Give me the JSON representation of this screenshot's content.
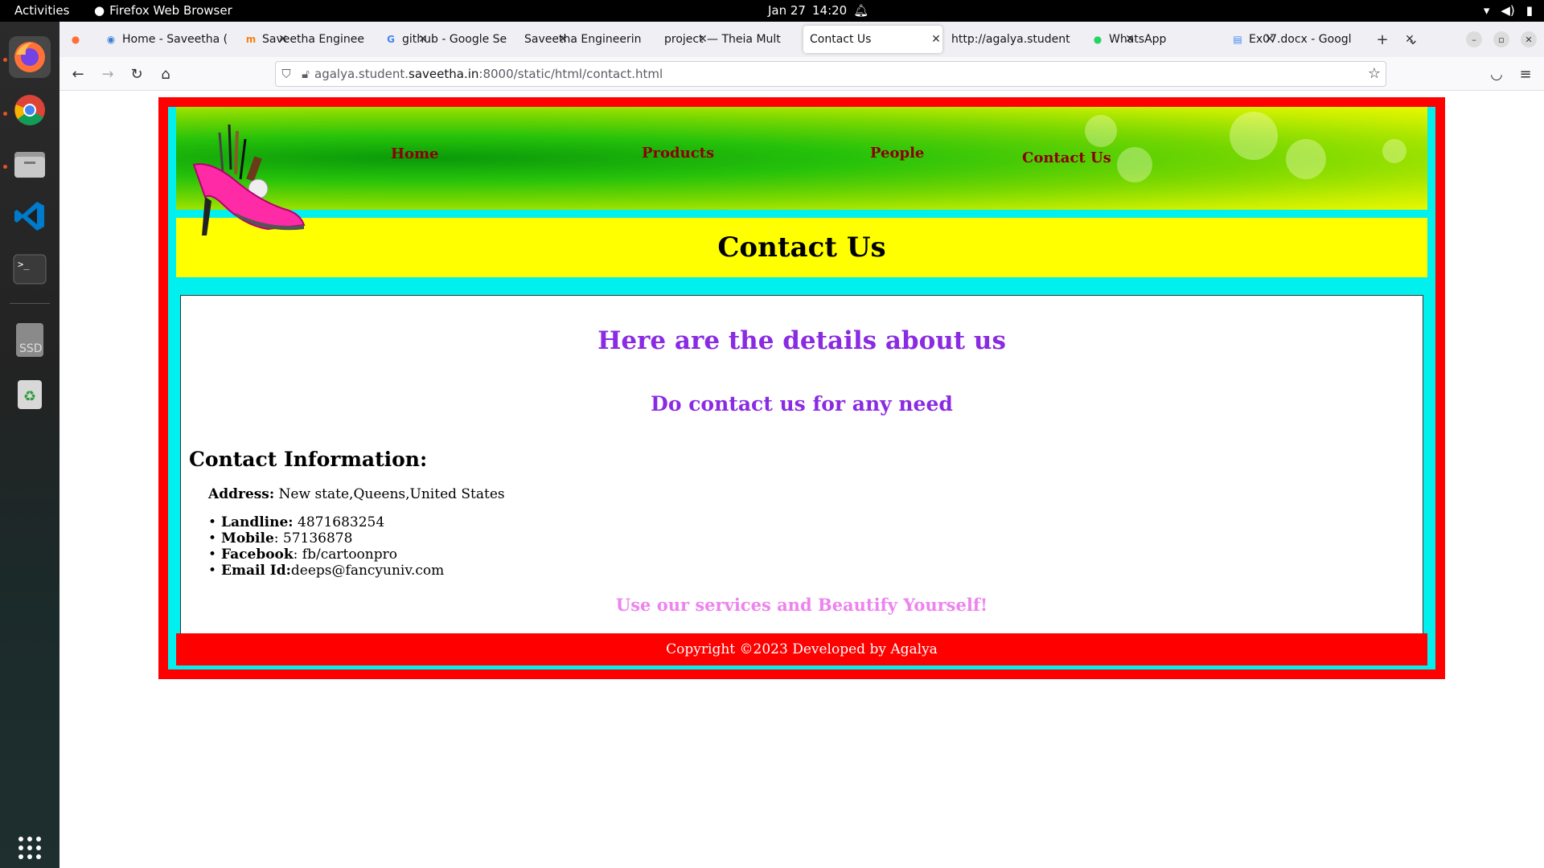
{
  "system": {
    "activities": "Activities",
    "app_name": "Firefox Web Browser",
    "date": "Jan 27",
    "time": "14:20"
  },
  "tabs": [
    {
      "label": "Home - Saveetha (",
      "icon": "saveetha-icon"
    },
    {
      "label": "Saveetha Enginee",
      "icon": "moodle-icon"
    },
    {
      "label": "github - Google Se",
      "icon": "google-icon"
    },
    {
      "label": "Saveetha Engineerin",
      "icon": ""
    },
    {
      "label": "project — Theia Mult",
      "icon": ""
    },
    {
      "label": "Contact Us",
      "icon": ""
    },
    {
      "label": "http://agalya.student",
      "icon": ""
    },
    {
      "label": "WhatsApp",
      "icon": "whatsapp-icon"
    },
    {
      "label": "Ex07.docx - Googl",
      "icon": "docs-icon"
    }
  ],
  "url": {
    "prefix": "agalya.student.",
    "domain": "saveetha.in",
    "suffix": ":8000/static/html/contact.html"
  },
  "site": {
    "nav": [
      "Home",
      "Products",
      "People",
      "Contact Us"
    ],
    "page_title": "Contact Us",
    "heading_details": "Here are the details about us",
    "heading_contact": "Do contact us for any need",
    "info_heading": "Contact Information:",
    "address_label": "Address:",
    "address_value": " New state,Queens,United States",
    "contacts": [
      {
        "label": "Landline:",
        "value": " 4871683254"
      },
      {
        "label": "Mobile",
        "value": ": 57136878"
      },
      {
        "label": "Facebook",
        "value": ": fb/cartoonpro"
      },
      {
        "label": "Email Id:",
        "value": "deeps@fancyuniv.com"
      }
    ],
    "cta": "Use our services and Beautify Yourself!",
    "footer": "Copyright ©2023 Developed by Agalya"
  },
  "colors": {
    "frame": "#ff0000",
    "cyan": "#00f0f0",
    "title_bg": "#ffff00",
    "purple": "#8a2be2",
    "nav_text": "#8b0000",
    "cta": "#ee82ee"
  }
}
